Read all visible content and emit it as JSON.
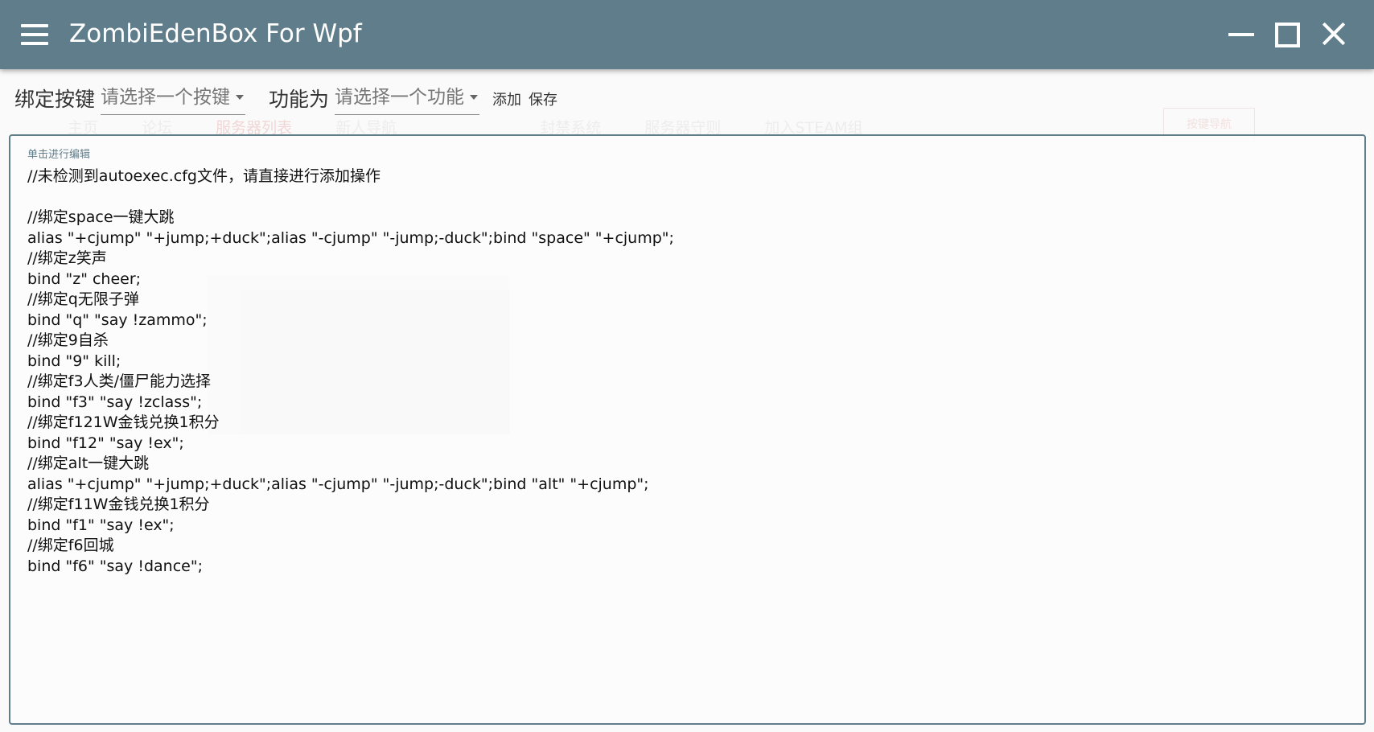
{
  "window": {
    "title": "ZombiEdenBox For Wpf",
    "menu_icon": "hamburger-menu-icon",
    "minimize_icon": "minimize-icon",
    "maximize_icon": "maximize-icon",
    "close_icon": "close-icon",
    "titlebar_color": "#607d8b"
  },
  "toolbar": {
    "bind_key_label": "绑定按键",
    "bind_key_placeholder": "请选择一个按键",
    "function_label": "功能为",
    "function_placeholder": "请选择一个功能",
    "add_label": "添加",
    "save_label": "保存"
  },
  "editor": {
    "hint": "单击进行编辑",
    "content": "//未检测到autoexec.cfg文件，请直接进行添加操作\n\n//绑定space一键大跳\nalias \"+cjump\" \"+jump;+duck\";alias \"-cjump\" \"-jump;-duck\";bind \"space\" \"+cjump\";\n//绑定z笑声\nbind \"z\" cheer;\n//绑定q无限子弹\nbind \"q\" \"say !zammo\";\n//绑定9自杀\nbind \"9\" kill;\n//绑定f3人类/僵尸能力选择\nbind \"f3\" \"say !zclass\";\n//绑定f121W金钱兑换1积分\nbind \"f12\" \"say !ex\";\n//绑定alt一键大跳\nalias \"+cjump\" \"+jump;+duck\";alias \"-cjump\" \"-jump;-duck\";bind \"alt\" \"+cjump\";\n//绑定f11W金钱兑换1积分\nbind \"f1\" \"say !ex\";\n//绑定f6回城\nbind \"f6\" \"say !dance\";"
  },
  "background": {
    "nav": [
      "主页",
      "论坛",
      "服务器列表",
      "新人导航",
      "",
      "封禁系统",
      "服务器守则",
      "加入STEAM组"
    ],
    "button": "按键导航"
  }
}
